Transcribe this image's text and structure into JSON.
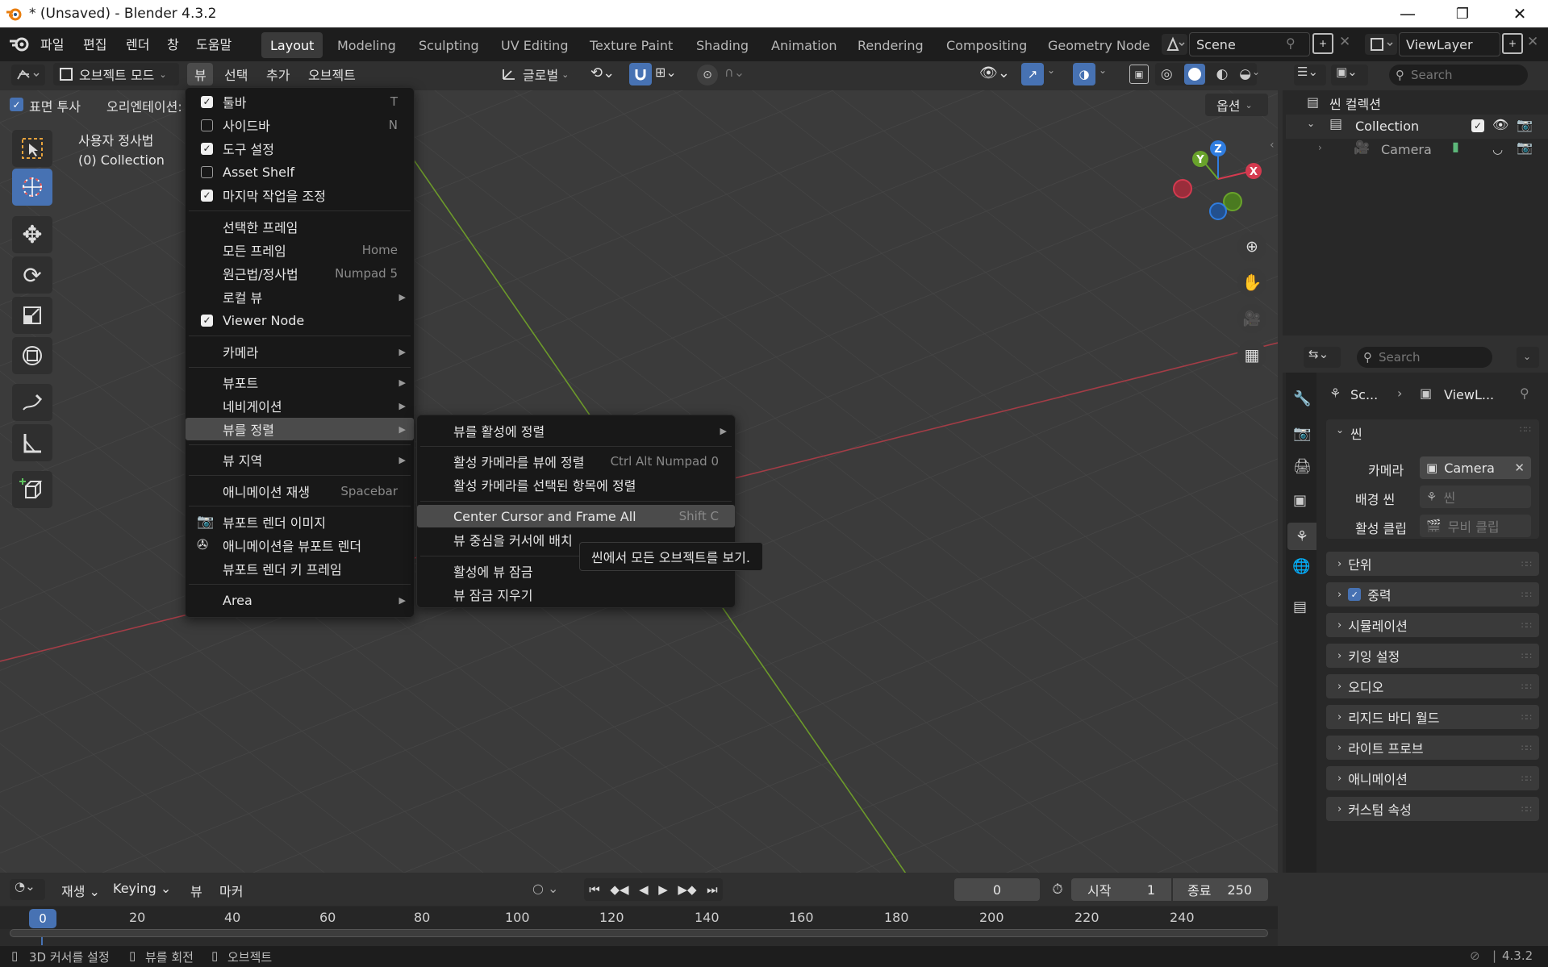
{
  "window": {
    "title": "* (Unsaved) - Blender 4.3.2",
    "minimize": "—",
    "maximize": "❐",
    "close": "✕"
  },
  "menubar": {
    "items": [
      "파일",
      "편집",
      "렌더",
      "창",
      "도움말"
    ]
  },
  "workspaces": {
    "tabs": [
      "Layout",
      "Modeling",
      "Sculpting",
      "UV Editing",
      "Texture Paint",
      "Shading",
      "Animation",
      "Rendering",
      "Compositing",
      "Geometry Node"
    ],
    "active": "Layout"
  },
  "scene_field": "Scene",
  "viewlayer_field": "ViewLayer",
  "viewport_header": {
    "mode": "오브젝트 모드",
    "menus": [
      "뷰",
      "선택",
      "추가",
      "오브젝트"
    ],
    "transform_orientation": "글로벌",
    "options_label": "옵션",
    "xray_label": "표면 투사",
    "orientation_label": "오리엔테이션:"
  },
  "viewport_info": {
    "line1": "사용자 정사법",
    "line2": "(0) Collection"
  },
  "gizmo": {
    "x": "X",
    "y": "Y",
    "z": "Z"
  },
  "view_menu": {
    "items": [
      {
        "label": "툴바",
        "shortcut": "T",
        "check": "on"
      },
      {
        "label": "사이드바",
        "shortcut": "N",
        "check": "off"
      },
      {
        "label": "도구 설정",
        "shortcut": "",
        "check": "on"
      },
      {
        "label": "Asset Shelf",
        "shortcut": "",
        "check": "off"
      },
      {
        "label": "마지막 작업을 조정",
        "shortcut": "",
        "check": "on"
      },
      {
        "label": "선택한 프레임",
        "shortcut": ""
      },
      {
        "label": "모든 프레임",
        "shortcut": "Home"
      },
      {
        "label": "원근법/정사법",
        "shortcut": "Numpad 5"
      },
      {
        "label": "로컬 뷰",
        "submenu": true
      },
      {
        "label": "Viewer Node",
        "check": "on"
      },
      {
        "label": "카메라",
        "submenu": true
      },
      {
        "label": "뷰포트",
        "submenu": true
      },
      {
        "label": "네비게이션",
        "submenu": true
      },
      {
        "label": "뷰를 정렬",
        "submenu": true
      },
      {
        "label": "뷰 지역",
        "submenu": true
      },
      {
        "label": "애니메이션 재생",
        "shortcut": "Spacebar"
      },
      {
        "label": "뷰포트 렌더 이미지"
      },
      {
        "label": "애니메이션을 뷰포트 렌더"
      },
      {
        "label": "뷰포트 렌더 키 프레임"
      },
      {
        "label": "Area",
        "submenu": true
      }
    ]
  },
  "align_submenu": {
    "items": [
      {
        "label": "뷰를 활성에 정렬",
        "shortcut": ""
      },
      {
        "label": "활성 카메라를 뷰에 정렬",
        "shortcut": "Ctrl Alt Numpad 0"
      },
      {
        "label": "활성 카메라를 선택된 항목에 정렬",
        "shortcut": ""
      },
      {
        "label": "Center Cursor and Frame All",
        "shortcut": "Shift C"
      },
      {
        "label": "뷰 중심을 커서에 배치",
        "shortcut": ""
      },
      {
        "label": "활성에 뷰 잠금",
        "shortcut": ""
      },
      {
        "label": "뷰 잠금 지우기",
        "shortcut": ""
      }
    ]
  },
  "tooltip": "씬에서 모든 오브젝트를 보기.",
  "outliner": {
    "search_placeholder": "Search",
    "root": "씬 컬렉션",
    "collection": "Collection",
    "camera": "Camera"
  },
  "properties": {
    "search_placeholder": "Search",
    "breadcrumb_scene": "Sc...",
    "breadcrumb_viewlayer": "ViewL...",
    "scene_section": "씬",
    "camera_label": "카메라",
    "camera_value": "Camera",
    "bg_scene_label": "배경 씬",
    "bg_scene_placeholder": "씬",
    "active_clip_label": "활성 클립",
    "active_clip_placeholder": "무비 클립",
    "panels": [
      "단위",
      "중력",
      "시뮬레이션",
      "키잉 설정",
      "오디오",
      "리지드 바디 월드",
      "라이트 프로브",
      "애니메이션",
      "커스텀 속성"
    ]
  },
  "timeline": {
    "menus": [
      "재생",
      "Keying",
      "뷰",
      "마커"
    ],
    "current_frame": "0",
    "start_label": "시작",
    "start_value": "1",
    "end_label": "종료",
    "end_value": "250",
    "ruler": [
      "0",
      "20",
      "40",
      "60",
      "80",
      "100",
      "120",
      "140",
      "160",
      "180",
      "200",
      "220",
      "240"
    ]
  },
  "statusbar": {
    "hints": [
      "3D 커서를 설정",
      "뷰를 회전",
      "오브젝트"
    ],
    "version": "4.3.2"
  }
}
